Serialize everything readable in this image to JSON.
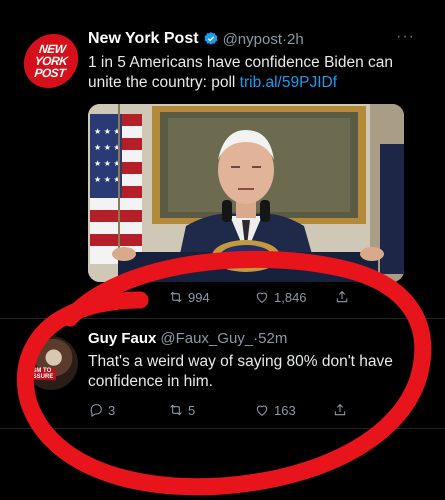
{
  "tweet1": {
    "avatar": {
      "lines": [
        "NEW",
        "YORK",
        "POST"
      ]
    },
    "name": "New York Post",
    "handle": "@nypost",
    "separator": "·",
    "time": "2h",
    "more": "···",
    "text": "1 in 5 Americans have confidence Biden can unite the country: poll ",
    "link": "trib.al/59PJIDf",
    "retweets": "994",
    "likes": "1,846"
  },
  "tweet2": {
    "avatar_tag": "ISM TO ESSURE",
    "name": "Guy Faux",
    "handle": "@Faux_Guy_",
    "separator": "·",
    "time": "52m",
    "text": "That's a weird way of saying 80% don't have confidence in him.",
    "replies": "3",
    "retweets": "5",
    "likes": "163"
  },
  "colors": {
    "background": "#000000",
    "link": "#1d9bf0",
    "muted": "#8b98a5",
    "verified": "#1d9bf0",
    "nyp_red": "#d6101a",
    "annotation_red": "#e8141c"
  },
  "icons": [
    "verified-badge-icon",
    "more-icon",
    "retweet-icon",
    "like-icon",
    "share-icon",
    "reply-icon"
  ]
}
